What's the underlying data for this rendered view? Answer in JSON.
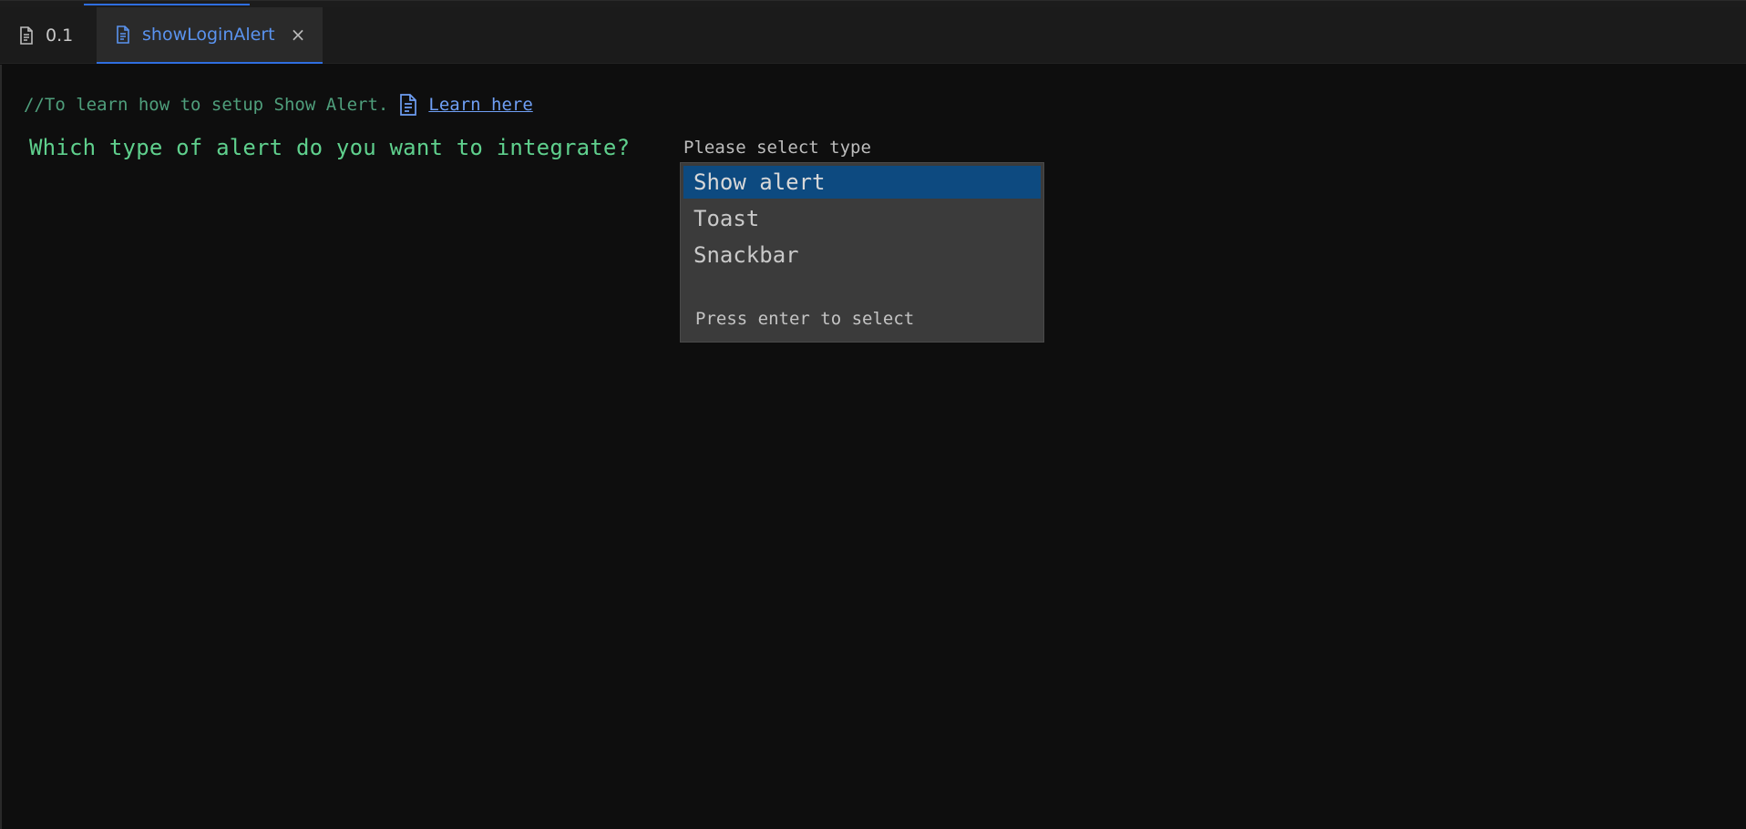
{
  "tabs": [
    {
      "label": "0.1",
      "icon": "document-icon",
      "active": false
    },
    {
      "label": "showLoginAlert",
      "icon": "document-icon",
      "active": true,
      "closable": true
    }
  ],
  "editor": {
    "comment_text": "//To learn how to setup Show Alert.",
    "learn_link_label": "Learn here",
    "question": "Which type of alert do you want to integrate?",
    "select_label": "Please select type",
    "options": [
      "Show alert",
      "Toast",
      "Snackbar"
    ],
    "selected_option": "Show alert",
    "hint": "Press enter to select"
  },
  "colors": {
    "accent": "#2f6ee0",
    "active_tab_text": "#5a93ef",
    "comment": "#4f9f7c",
    "question": "#5fd08d",
    "link": "#6f9ff5",
    "selected_option_bg": "#0d4a80",
    "background": "#0e0e0e"
  }
}
